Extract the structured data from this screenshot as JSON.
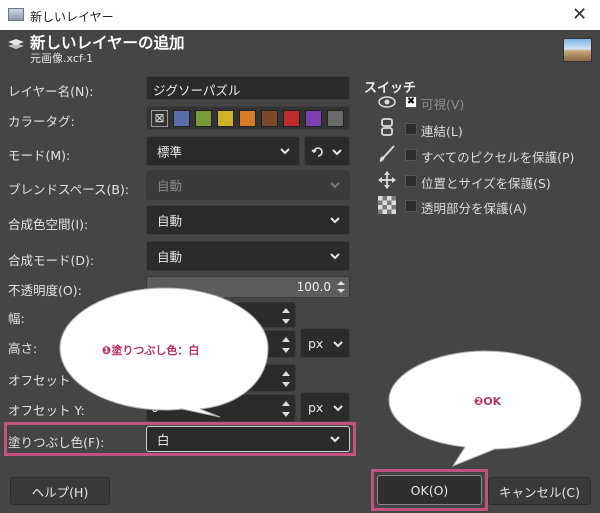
{
  "window": {
    "title": "新しいレイヤー",
    "close": "✕"
  },
  "header": {
    "title": "新しいレイヤーの追加",
    "subtitle": "元画像.xcf-1"
  },
  "form": {
    "layer_name_label": "レイヤー名(N):",
    "layer_name_value": "ジグソーパズル",
    "color_tag_label": "カラータグ:",
    "color_tags": [
      "#5a6fa8",
      "#7a9a3a",
      "#d0b228",
      "#d97a24",
      "#7a4a2a",
      "#c02c2c",
      "#7a3fb0",
      "#6a6a6a"
    ],
    "mode_label": "モード(M):",
    "mode_value": "標準",
    "blend_space_label": "ブレンドスペース(B):",
    "blend_space_value": "自動",
    "composite_space_label": "合成色空間(I):",
    "composite_space_value": "自動",
    "composite_mode_label": "合成モード(D):",
    "composite_mode_value": "自動",
    "opacity_label": "不透明度(O):",
    "opacity_value": "100.0",
    "width_label": "幅:",
    "height_label": "高さ:",
    "offset_x_label": "オフセット",
    "offset_y_label": "オフセット Y:",
    "offset_y_value": "0",
    "unit_value": "px",
    "fill_label": "塗りつぶし色(F):",
    "fill_value": "白"
  },
  "switches": {
    "title": "スイッチ",
    "items": [
      {
        "label": "可視(V)",
        "checked": true,
        "icon": "eye-icon"
      },
      {
        "label": "連結(L)",
        "checked": false,
        "icon": "chain-icon"
      },
      {
        "label": "すべてのピクセルを保護(P)",
        "checked": false,
        "icon": "brush-icon"
      },
      {
        "label": "位置とサイズを保護(S)",
        "checked": false,
        "icon": "move-icon"
      },
      {
        "label": "透明部分を保護(A)",
        "checked": false,
        "icon": "checker-icon"
      }
    ]
  },
  "buttons": {
    "help": "ヘルプ(H)",
    "ok": "OK(O)",
    "cancel": "キャンセル(C)"
  },
  "annotations": {
    "bubble1": "❶塗りつぶし色：白",
    "bubble2": "❷OK"
  },
  "colors": {
    "accent": "#c2537f",
    "bg": "#454545"
  }
}
